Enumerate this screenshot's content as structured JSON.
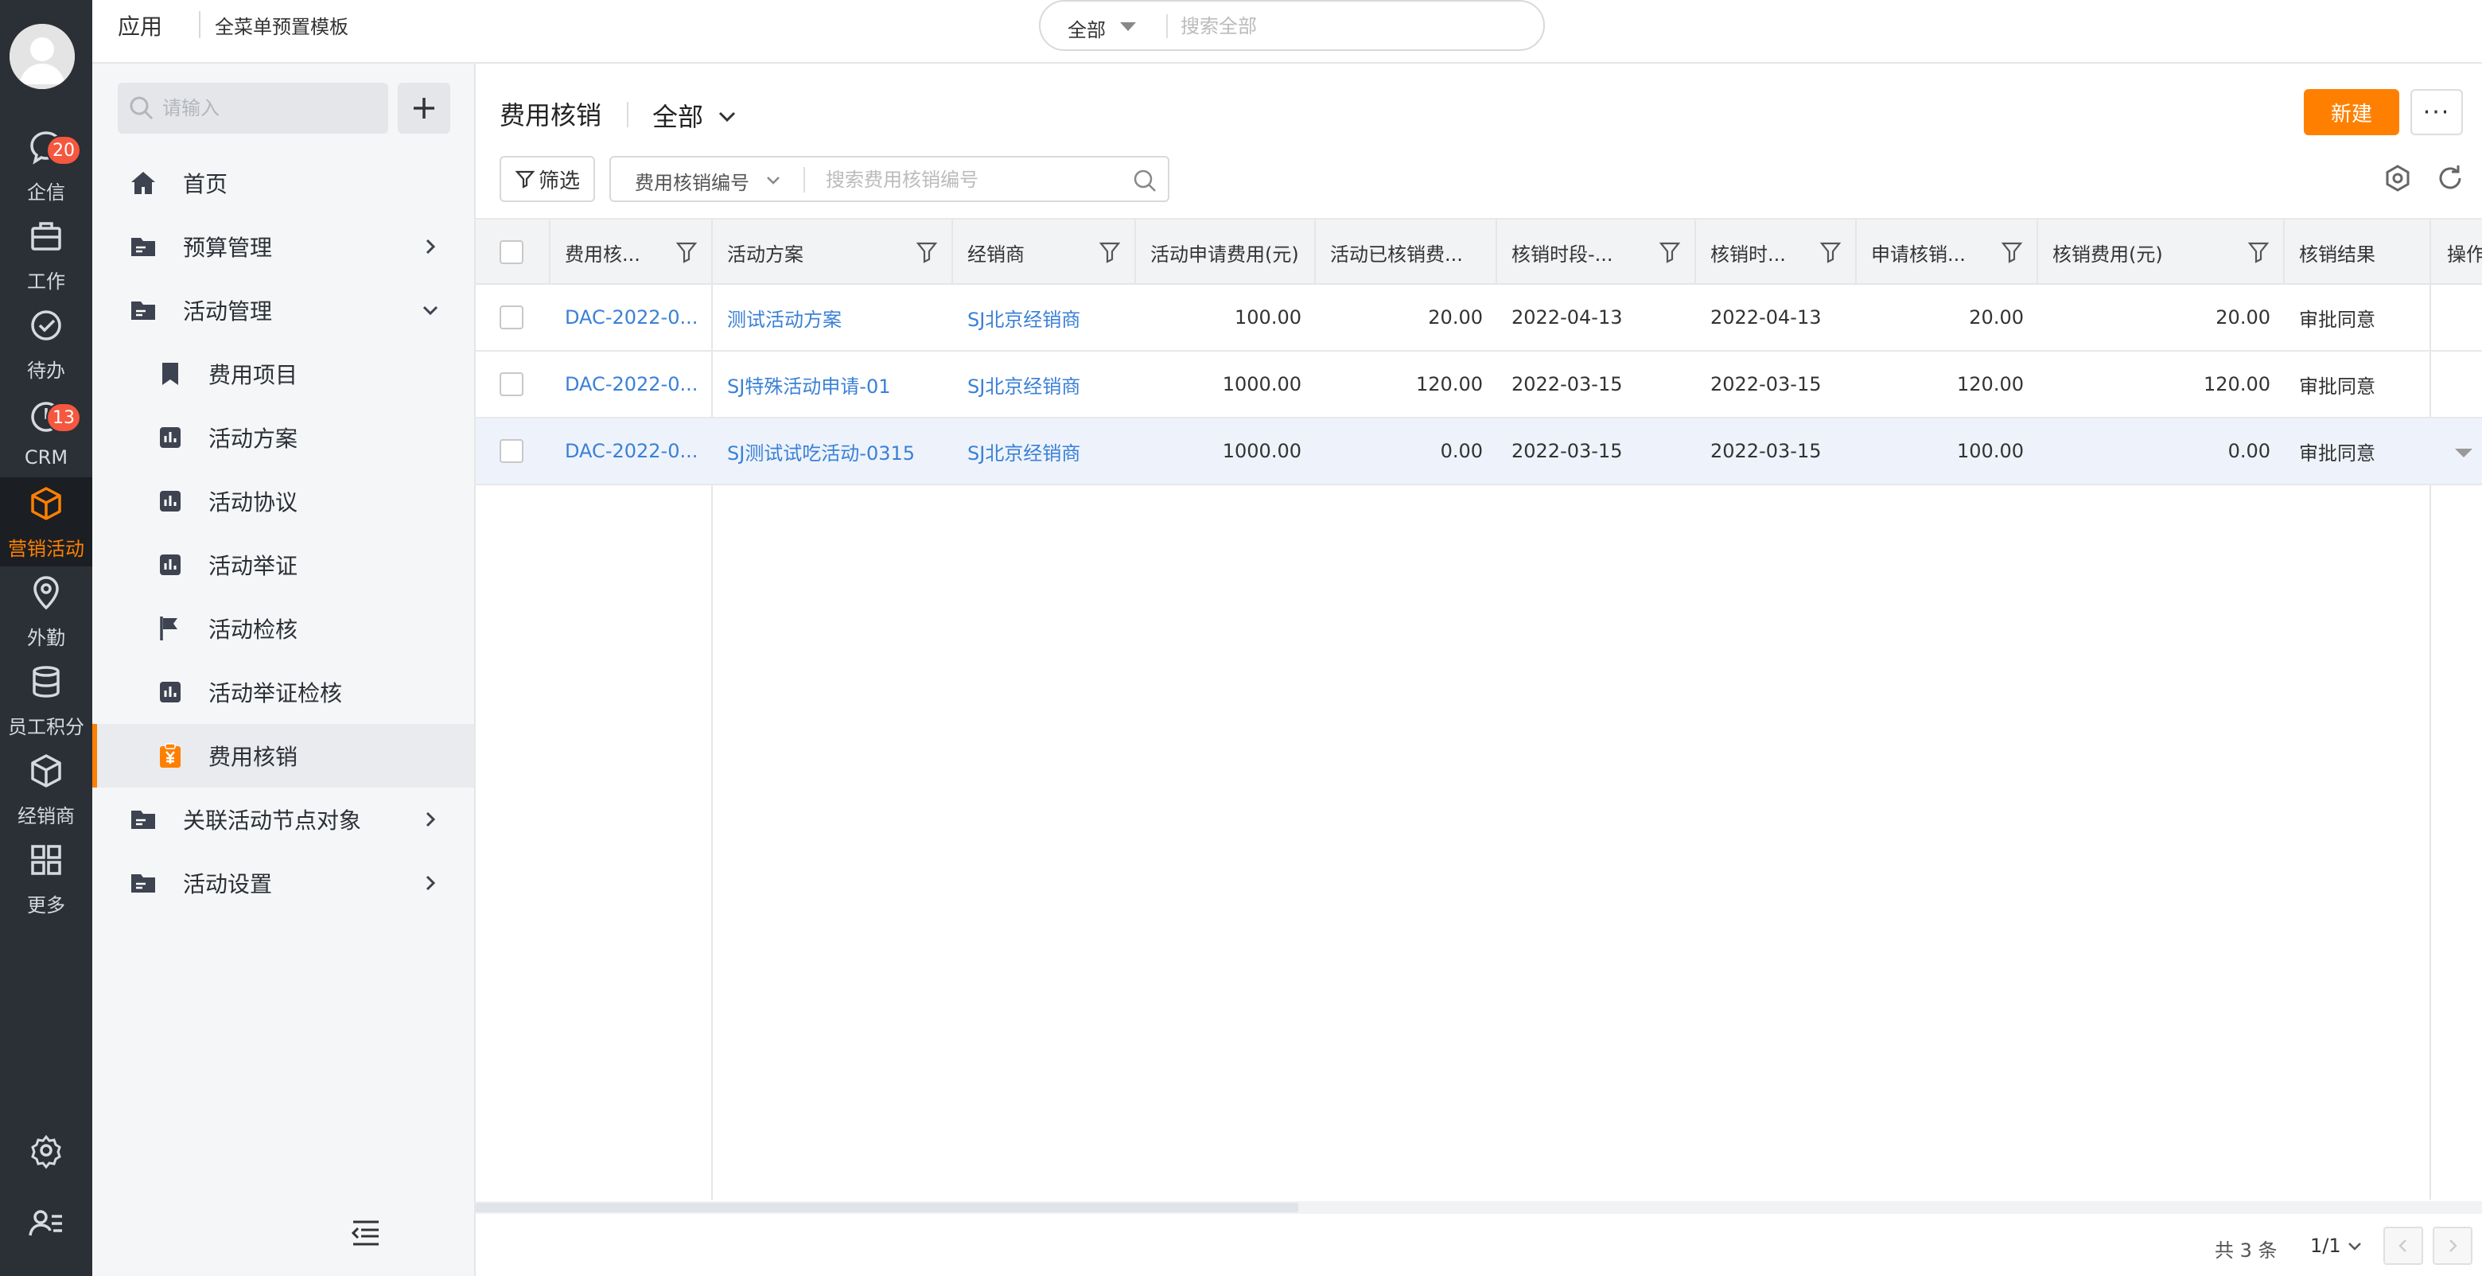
{
  "topbar": {
    "app_label": "应用",
    "template_label": "全菜单预置模板",
    "search_scope": "全部",
    "search_placeholder": "搜索全部"
  },
  "rail": {
    "items": [
      {
        "label": "企信",
        "icon": "chat-icon",
        "badge": "20"
      },
      {
        "label": "工作",
        "icon": "briefcase-icon"
      },
      {
        "label": "待办",
        "icon": "check-circle-icon"
      },
      {
        "label": "CRM",
        "icon": "clock-icon",
        "badge": "13"
      },
      {
        "label": "营销活动",
        "icon": "cube-icon",
        "active": true
      },
      {
        "label": "外勤",
        "icon": "location-pin-icon"
      },
      {
        "label": "员工积分",
        "icon": "database-icon"
      },
      {
        "label": "经销商",
        "icon": "box-icon"
      },
      {
        "label": "更多",
        "icon": "grid-icon"
      }
    ],
    "settings_icon": "gear-icon",
    "profile_icon": "user-list-icon",
    "active_color": "#ff8000"
  },
  "nav": {
    "search_placeholder": "请输入",
    "items": [
      {
        "label": "首页",
        "icon": "home-icon",
        "level": 1
      },
      {
        "label": "预算管理",
        "icon": "folder-icon",
        "level": 1,
        "chevron": "right"
      },
      {
        "label": "活动管理",
        "icon": "folder-icon",
        "level": 1,
        "chevron": "down"
      },
      {
        "label": "费用项目",
        "icon": "bookmark-icon",
        "level": 2
      },
      {
        "label": "活动方案",
        "icon": "chart-square-icon",
        "level": 2
      },
      {
        "label": "活动协议",
        "icon": "chart-square-icon",
        "level": 2
      },
      {
        "label": "活动举证",
        "icon": "chart-square-icon",
        "level": 2
      },
      {
        "label": "活动检核",
        "icon": "flag-icon",
        "level": 2
      },
      {
        "label": "活动举证检核",
        "icon": "chart-square-icon",
        "level": 2
      },
      {
        "label": "费用核销",
        "icon": "yen-clipboard-icon",
        "level": 2,
        "active": true
      },
      {
        "label": "关联活动节点对象",
        "icon": "folder-icon",
        "level": 1,
        "chevron": "right"
      },
      {
        "label": "活动设置",
        "icon": "folder-icon",
        "level": 1,
        "chevron": "right"
      }
    ]
  },
  "main": {
    "title": "费用核销",
    "view": "全部",
    "new_button": "新建",
    "more_button": "···",
    "filter_button": "筛选",
    "search_field": "费用核销编号",
    "search_placeholder": "搜索费用核销编号",
    "accent": "#ff8000",
    "link_color": "#3a80d6"
  },
  "table": {
    "columns": [
      "费用核...",
      "活动方案",
      "经销商",
      "活动申请费用(元)",
      "活动已核销费...",
      "核销时段-...",
      "核销时...",
      "申请核销...",
      "核销费用(元)",
      "核销结果",
      "操作"
    ],
    "rows": [
      [
        "DAC-2022-0...",
        "测试活动方案",
        "SJ北京经销商",
        "100.00",
        "20.00",
        "2022-04-13",
        "2022-04-13",
        "20.00",
        "20.00",
        "审批同意"
      ],
      [
        "DAC-2022-0...",
        "SJ特殊活动申请-01",
        "SJ北京经销商",
        "1000.00",
        "120.00",
        "2022-03-15",
        "2022-03-15",
        "120.00",
        "120.00",
        "审批同意"
      ],
      [
        "DAC-2022-0...",
        "SJ测试试吃活动-0315",
        "SJ北京经销商",
        "1000.00",
        "0.00",
        "2022-03-15",
        "2022-03-15",
        "100.00",
        "0.00",
        "审批同意"
      ]
    ],
    "horizontal_scroll_fraction": 0.41
  },
  "pager": {
    "total": "共 3 条",
    "page": "1/1"
  }
}
